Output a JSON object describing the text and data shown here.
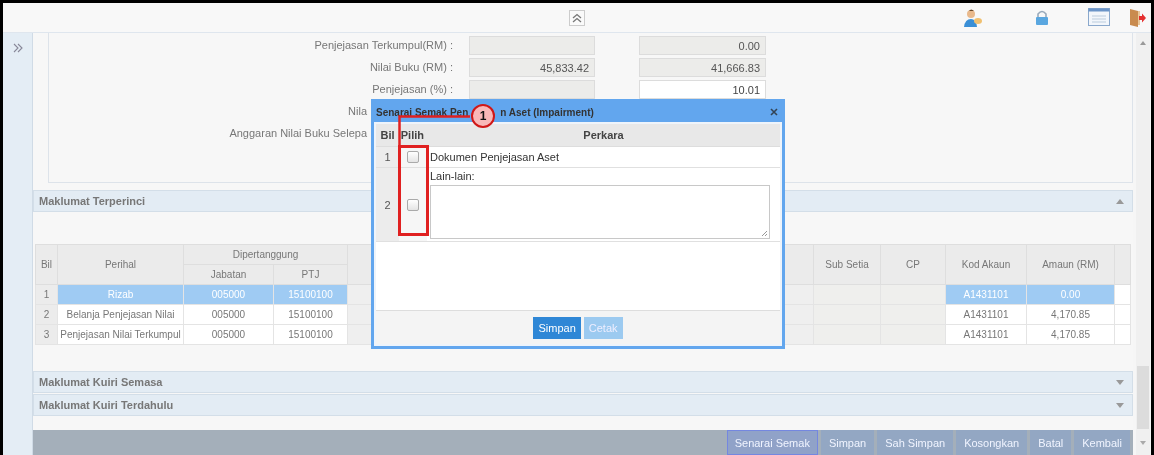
{
  "summary_form": {
    "rows": [
      {
        "label": "Penjejasan Terkumpul(RM) :",
        "fields": [
          {
            "editable": false
          },
          {
            "value": "0.00",
            "editable": false
          }
        ]
      },
      {
        "label": "Nilai Buku (RM) :",
        "fields": [
          {
            "value": "45,833.42",
            "editable": false
          },
          {
            "value": "41,666.83",
            "editable": false
          }
        ]
      },
      {
        "label": "Penjejasan (%) :",
        "fields": [
          {
            "editable": false
          },
          {
            "value": "10.01",
            "editable": true
          }
        ]
      },
      {
        "label": "Nila"
      },
      {
        "label": "Anggaran Nilai Buku Selepa"
      }
    ]
  },
  "sections": [
    {
      "title": "Maklumat Terperinci",
      "expanded": true
    },
    {
      "title": "Maklumat Kuiri Semasa",
      "expanded": false
    },
    {
      "title": "Maklumat Kuiri Terdahulu",
      "expanded": false
    }
  ],
  "detail_table": {
    "group_header": "Dipertanggung",
    "columns": {
      "bil": "Bil",
      "perihal": "Perihal",
      "jabatan": "Jabatan",
      "ptj": "PTJ",
      "sub_setia": "Sub Setia",
      "cp": "CP",
      "kod_akaun": "Kod Akaun",
      "amaun": "Amaun (RM)"
    },
    "rows": [
      {
        "selected": true,
        "bil": "1",
        "perihal": "Rizab",
        "jabatan": "005000",
        "ptj": "15100100",
        "kod_akaun": "A1431101",
        "amaun": "0.00"
      },
      {
        "selected": false,
        "bil": "2",
        "perihal": "Belanja Penjejasan Nilai",
        "jabatan": "005000",
        "ptj": "15100100",
        "kod_akaun": "A1431101",
        "amaun": "4,170.85"
      },
      {
        "selected": false,
        "bil": "3",
        "perihal": "Penjejasan Nilai Terkumpul",
        "jabatan": "005000",
        "ptj": "15100100",
        "kod_akaun": "A1431101",
        "amaun": "4,170.85"
      }
    ]
  },
  "modal": {
    "title_parts": [
      "Senarai Semak Pen",
      "n Aset (Impairment)"
    ],
    "columns": [
      "Bil",
      "Pilih",
      "Perkara"
    ],
    "items": [
      {
        "kind": "text",
        "number": "1",
        "checked": false,
        "label": "Dokumen Penjejasan Aset"
      },
      {
        "kind": "textarea",
        "number": "2",
        "checked": false,
        "label": "Lain-lain:"
      }
    ],
    "buttons": [
      {
        "label": "Simpan",
        "disabled": false
      },
      {
        "label": "Cetak",
        "disabled": true
      }
    ]
  },
  "callout": {
    "number": "1"
  },
  "action_bar": {
    "buttons": [
      {
        "label": "Senarai Semak",
        "selected": true
      },
      {
        "label": "Simpan",
        "selected": false
      },
      {
        "label": "Sah Simpan",
        "selected": false
      },
      {
        "label": "Kosongkan",
        "selected": false
      },
      {
        "label": "Batal",
        "selected": false
      },
      {
        "label": "Kembali",
        "selected": false
      }
    ]
  }
}
